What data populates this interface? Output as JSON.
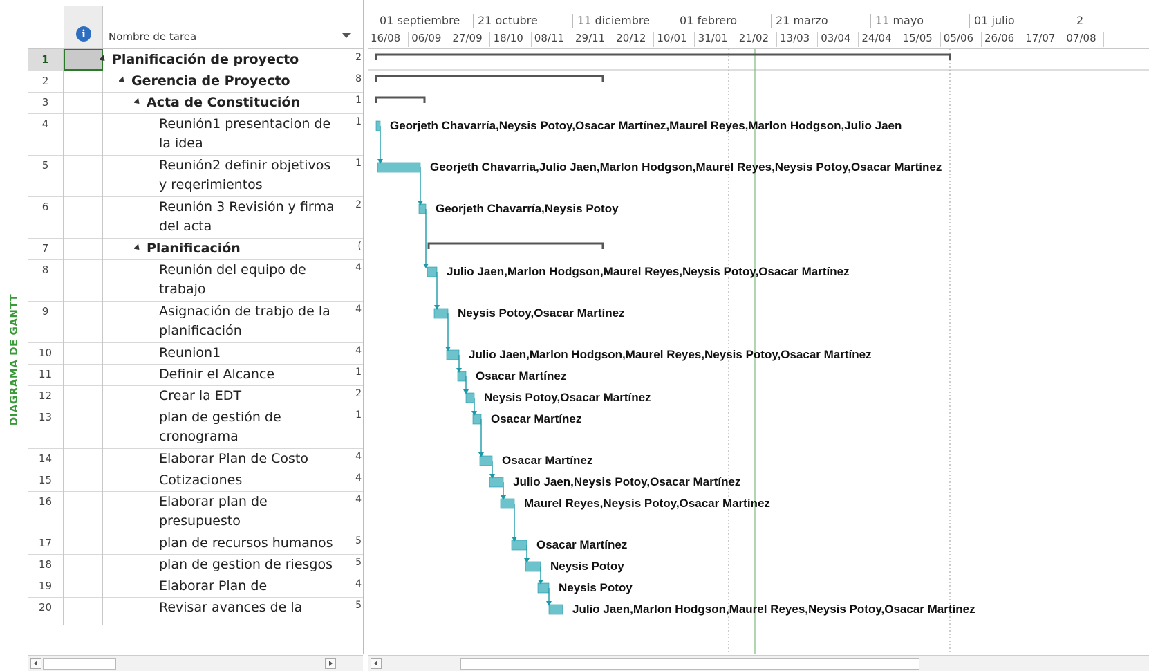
{
  "view": {
    "label": "DIAGRAMA DE GANTT"
  },
  "table": {
    "header": {
      "task_name": "Nombre de tarea"
    },
    "rows": [
      {
        "num": "1",
        "name": "Planificación de proyecto MIPY",
        "level": 0,
        "summary": true,
        "trail": "2",
        "selected": true
      },
      {
        "num": "2",
        "name": "Gerencia de Proyecto",
        "level": 1,
        "summary": true,
        "trail": "8"
      },
      {
        "num": "3",
        "name": "Acta de Constitución",
        "level": 2,
        "summary": true,
        "trail": "1"
      },
      {
        "num": "4",
        "name": "Reunión1 presentacion de la idea",
        "level": 3,
        "summary": false,
        "trail": "1"
      },
      {
        "num": "5",
        "name": "Reunión2 definir objetivos y reqerimientos",
        "level": 3,
        "summary": false,
        "trail": "1"
      },
      {
        "num": "6",
        "name": "Reunión 3 Revisión y firma del acta",
        "level": 3,
        "summary": false,
        "trail": "2"
      },
      {
        "num": "7",
        "name": "Planificación",
        "level": 2,
        "summary": true,
        "trail": "("
      },
      {
        "num": "8",
        "name": "Reunión del equipo de trabajo",
        "level": 3,
        "summary": false,
        "trail": "4"
      },
      {
        "num": "9",
        "name": "Asignación de trabjo de la planificación",
        "level": 3,
        "summary": false,
        "trail": "4"
      },
      {
        "num": "10",
        "name": " Reunion1",
        "level": 3,
        "summary": false,
        "trail": "4"
      },
      {
        "num": "11",
        "name": "Definir el Alcance",
        "level": 3,
        "summary": false,
        "trail": "1"
      },
      {
        "num": "12",
        "name": "Crear la EDT",
        "level": 3,
        "summary": false,
        "trail": "2"
      },
      {
        "num": "13",
        "name": "plan de gestión de cronograma",
        "level": 3,
        "summary": false,
        "trail": "1"
      },
      {
        "num": "14",
        "name": "Elaborar Plan de Costo",
        "level": 3,
        "summary": false,
        "trail": "4"
      },
      {
        "num": "15",
        "name": " Cotizaciones",
        "level": 3,
        "summary": false,
        "trail": "4"
      },
      {
        "num": "16",
        "name": "Elaborar plan de presupuesto",
        "level": 3,
        "summary": false,
        "trail": "4"
      },
      {
        "num": "17",
        "name": "plan de recursos humanos",
        "level": 3,
        "summary": false,
        "trail": "5"
      },
      {
        "num": "18",
        "name": "plan de gestion de riesgos",
        "level": 3,
        "summary": false,
        "trail": "5"
      },
      {
        "num": "19",
        "name": "Elaborar Plan de Adquisicior",
        "level": 3,
        "summary": false,
        "trail": "4"
      },
      {
        "num": "20",
        "name": "Revisar avances de la",
        "level": 3,
        "summary": false,
        "trail": "5"
      }
    ]
  },
  "timeline": {
    "top": [
      "01 septiembre",
      "21 octubre",
      "11 diciembre",
      "01 febrero",
      "21 marzo",
      "11 mayo",
      "01 julio",
      "2"
    ],
    "bottom": [
      "16/08",
      "06/09",
      "27/09",
      "18/10",
      "08/11",
      "29/11",
      "20/12",
      "10/01",
      "31/01",
      "21/02",
      "13/03",
      "03/04",
      "24/04",
      "15/05",
      "05/06",
      "26/06",
      "17/07",
      "07/08"
    ]
  },
  "gantt": {
    "colors": {
      "bar": "#6cc3cc",
      "bar_dark": "#1a9aa8",
      "summary": "#555555",
      "today": "#7dba7d",
      "link": "#1a9aa8"
    },
    "tasks": [
      {
        "resources": ""
      },
      {
        "resources": ""
      },
      {
        "resources": ""
      },
      {
        "resources": "Georjeth Chavarría,Neysis Potoy,Osacar Martínez,Maurel Reyes,Marlon Hodgson,Julio Jaen"
      },
      {
        "resources": "Georjeth Chavarría,Julio Jaen,Marlon Hodgson,Maurel Reyes,Neysis Potoy,Osacar Martínez"
      },
      {
        "resources": "Georjeth Chavarría,Neysis Potoy"
      },
      {
        "resources": ""
      },
      {
        "resources": "Julio Jaen,Marlon Hodgson,Maurel Reyes,Neysis Potoy,Osacar Martínez"
      },
      {
        "resources": "Neysis Potoy,Osacar Martínez"
      },
      {
        "resources": "Julio Jaen,Marlon Hodgson,Maurel Reyes,Neysis Potoy,Osacar Martínez"
      },
      {
        "resources": "Osacar Martínez"
      },
      {
        "resources": "Neysis Potoy,Osacar Martínez"
      },
      {
        "resources": "Osacar Martínez"
      },
      {
        "resources": "Osacar Martínez"
      },
      {
        "resources": "Julio Jaen,Neysis Potoy,Osacar Martínez"
      },
      {
        "resources": "Maurel Reyes,Neysis Potoy,Osacar Martínez"
      },
      {
        "resources": "Osacar Martínez"
      },
      {
        "resources": "Neysis Potoy"
      },
      {
        "resources": "Neysis Potoy"
      },
      {
        "resources": "Julio Jaen,Marlon Hodgson,Maurel Reyes,Neysis Potoy,Osacar Martínez"
      }
    ]
  }
}
